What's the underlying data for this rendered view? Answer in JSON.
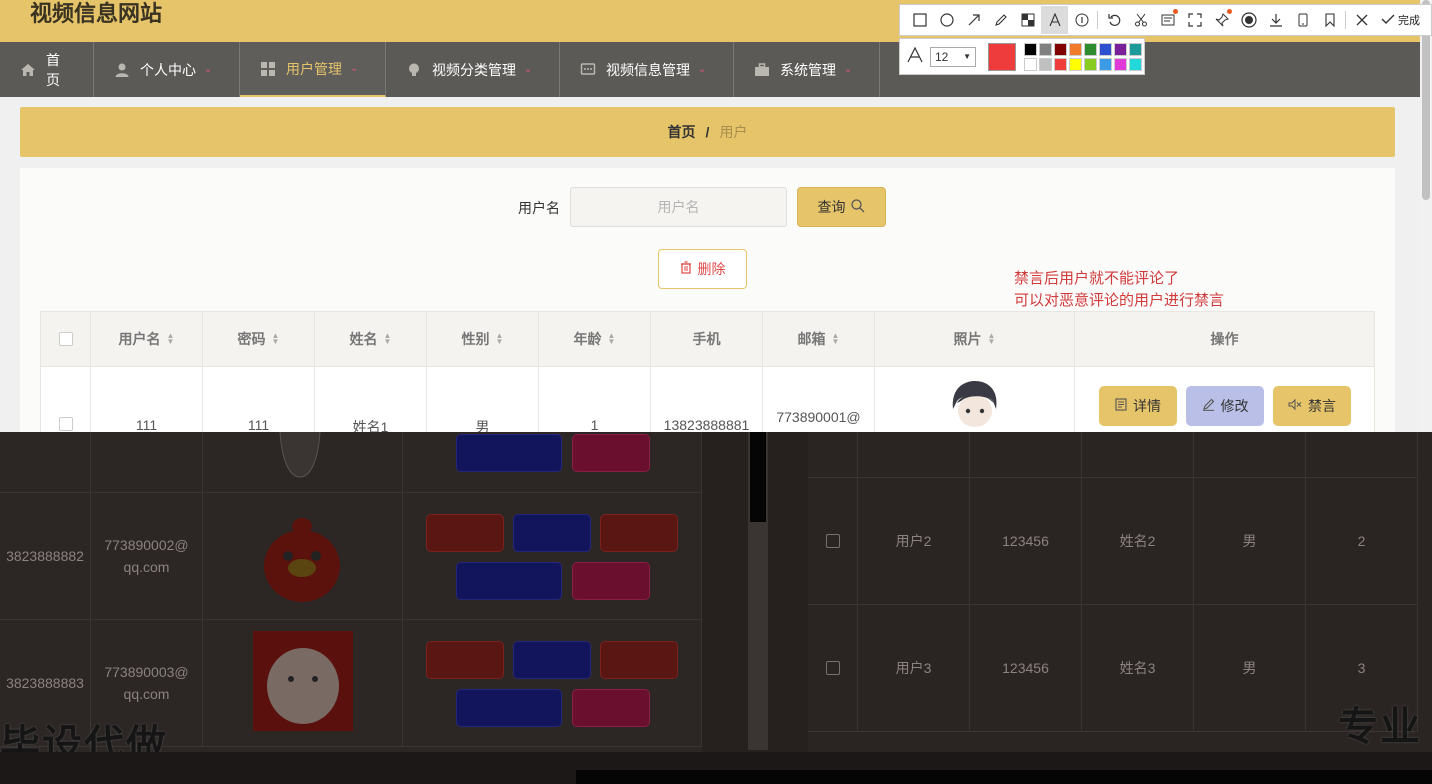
{
  "header": {
    "title": "视频信息网站"
  },
  "nav": {
    "items": [
      {
        "label": "首页",
        "icon": "home-icon",
        "has_caret": false
      },
      {
        "label": "个人中心",
        "icon": "user-icon",
        "has_caret": true
      },
      {
        "label": "用户管理",
        "icon": "grid-icon",
        "has_caret": true,
        "active": true
      },
      {
        "label": "视频分类管理",
        "icon": "bulb-icon",
        "has_caret": true
      },
      {
        "label": "视频信息管理",
        "icon": "chat-icon",
        "has_caret": true
      },
      {
        "label": "系统管理",
        "icon": "briefcase-icon",
        "has_caret": true
      }
    ]
  },
  "breadcrumb": {
    "home": "首页",
    "separator": "/",
    "current": "用户"
  },
  "search": {
    "label": "用户名",
    "placeholder": "用户名",
    "query_label": "查询"
  },
  "actions": {
    "delete_label": "删除"
  },
  "annotation": {
    "line1": "禁言后用户就不能评论了",
    "line2": "可以对恶意评论的用户进行禁言"
  },
  "table": {
    "headers": [
      "用户名",
      "密码",
      "姓名",
      "性别",
      "年龄",
      "手机",
      "邮箱",
      "照片",
      "操作"
    ],
    "row1": {
      "username": "111",
      "password": "111",
      "name": "姓名1",
      "gender": "男",
      "age": "1",
      "phone": "13823888881",
      "email": "773890001@"
    },
    "buttons": {
      "detail": "详情",
      "edit": "修改",
      "ban": "禁言"
    }
  },
  "toolbar": {
    "font_size": "12",
    "done_label": "完成",
    "current_color": "#ee3b3b",
    "palette": [
      "#000000",
      "#808080",
      "#800000",
      "#f07b2a",
      "#2e8b2e",
      "#2e4fd0",
      "#7a1f9a",
      "#1f9a9a",
      "#ffffff",
      "#c0c0c0",
      "#ee3b3b",
      "#ffff00",
      "#88cc22",
      "#3b9be6",
      "#e03bd8",
      "#22d8d8"
    ]
  },
  "lower": {
    "rows": [
      {
        "phone": "3823888882",
        "email1": "773890002@",
        "email2": "qq.com"
      },
      {
        "phone": "3823888883",
        "email1": "773890003@",
        "email2": "qq.com"
      }
    ],
    "right_rows": [
      {
        "username": "用户2",
        "password": "123456",
        "name": "姓名2",
        "gender": "男",
        "age": "2"
      },
      {
        "username": "用户3",
        "password": "123456",
        "name": "姓名3",
        "gender": "男",
        "age": "3"
      }
    ],
    "watermark_left": "毕设代做",
    "watermark_right": "专业"
  },
  "colors": {
    "accent": "#e6c46a",
    "nav_bg": "#5b5a57",
    "danger": "#e04848"
  }
}
